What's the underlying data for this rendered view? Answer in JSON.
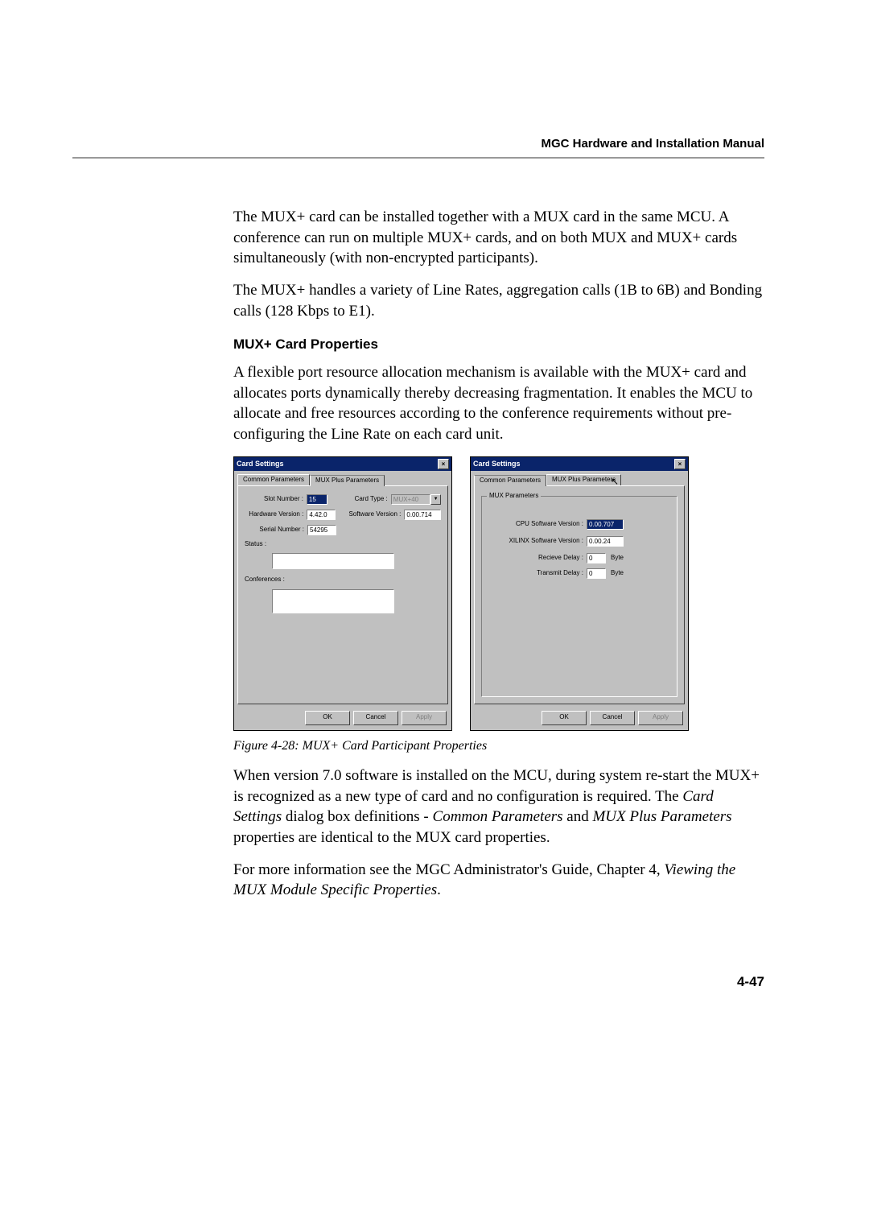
{
  "header": {
    "manual_title": "MGC Hardware and Installation Manual"
  },
  "paras": {
    "p1": "The MUX+ card can be installed together with a MUX card in the same MCU. A conference can run on multiple MUX+ cards, and on both MUX and MUX+ cards simultaneously (with non-encrypted participants).",
    "p2": "The MUX+ handles a variety of Line Rates, aggregation calls (1B to 6B) and Bonding calls (128 Kbps to E1).",
    "subhead": "MUX+ Card Properties",
    "p3": "A flexible port resource allocation mechanism is available with the MUX+ card and allocates ports dynamically thereby decreasing fragmentation. It enables the MCU to allocate and free resources according to the conference requirements without pre-configuring the Line Rate on each card unit.",
    "figcap": "Figure 4-28: MUX+ Card Participant Properties",
    "p4a": "When version 7.0 software is installed on the MCU, during system re-start the MUX+ is recognized as a new type of card and no configuration is required. The ",
    "p4b": "Card Settings",
    "p4c": " dialog box definitions - ",
    "p4d": "Common Parameters",
    "p4e": " and ",
    "p4f": "MUX Plus Parameters",
    "p4g": " properties are identical to the MUX card properties.",
    "p5a": "For more information see the MGC Administrator's Guide, Chapter 4, ",
    "p5b": "Viewing the MUX Module Specific Properties",
    "p5c": "."
  },
  "dialog_left": {
    "title": "Card Settings",
    "tab1": "Common Parameters",
    "tab2": "MUX Plus Parameters",
    "slot_label": "Slot Number :",
    "slot_value": "15",
    "cardtype_label": "Card Type :",
    "cardtype_value": "MUX+40",
    "hw_label": "Hardware Version :",
    "hw_value": "4.42.0",
    "sw_label": "Software Version :",
    "sw_value": "0.00.714",
    "serial_label": "Serial Number :",
    "serial_value": "54295",
    "status_label": "Status :",
    "conf_label": "Conferences :",
    "ok": "OK",
    "cancel": "Cancel",
    "apply": "Apply"
  },
  "dialog_right": {
    "title": "Card Settings",
    "tab1": "Common Parameters",
    "tab2": "MUX Plus Parameters",
    "group_label": "MUX Parameters",
    "cpu_label": "CPU Software Version :",
    "cpu_value": "0.00.707",
    "xilinx_label": "XILINX Software Version :",
    "xilinx_value": "0.00.24",
    "recv_label": "Recieve Delay :",
    "recv_value": "0",
    "recv_unit": "Byte",
    "trans_label": "Transmit Delay :",
    "trans_value": "0",
    "trans_unit": "Byte",
    "ok": "OK",
    "cancel": "Cancel",
    "apply": "Apply"
  },
  "page_number": "4-47"
}
